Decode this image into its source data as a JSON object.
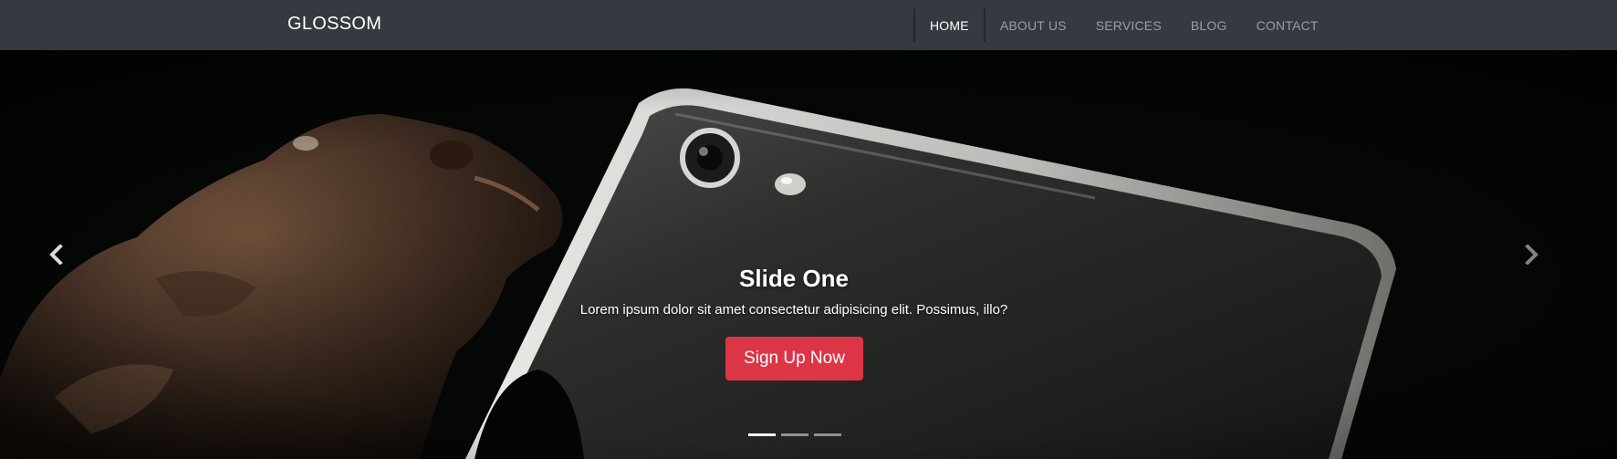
{
  "navbar": {
    "brand": "GLOSSOM",
    "items": [
      {
        "label": "HOME",
        "active": true
      },
      {
        "label": "ABOUT US",
        "active": false
      },
      {
        "label": "SERVICES",
        "active": false
      },
      {
        "label": "BLOG",
        "active": false
      },
      {
        "label": "CONTACT",
        "active": false
      }
    ]
  },
  "carousel": {
    "slide": {
      "title": "Slide One",
      "text": "Lorem ipsum dolor sit amet consectetur adipisicing elit. Possimus, illo?",
      "button_label": "Sign Up Now"
    },
    "slide_count": 3,
    "active_index": 0,
    "prev_icon": "chevron-left-icon",
    "next_icon": "chevron-right-icon"
  },
  "colors": {
    "navbar_bg": "#343a40",
    "button_bg": "#dc3545",
    "nav_active": "#ffffff",
    "nav_inactive": "#9a9da1"
  }
}
